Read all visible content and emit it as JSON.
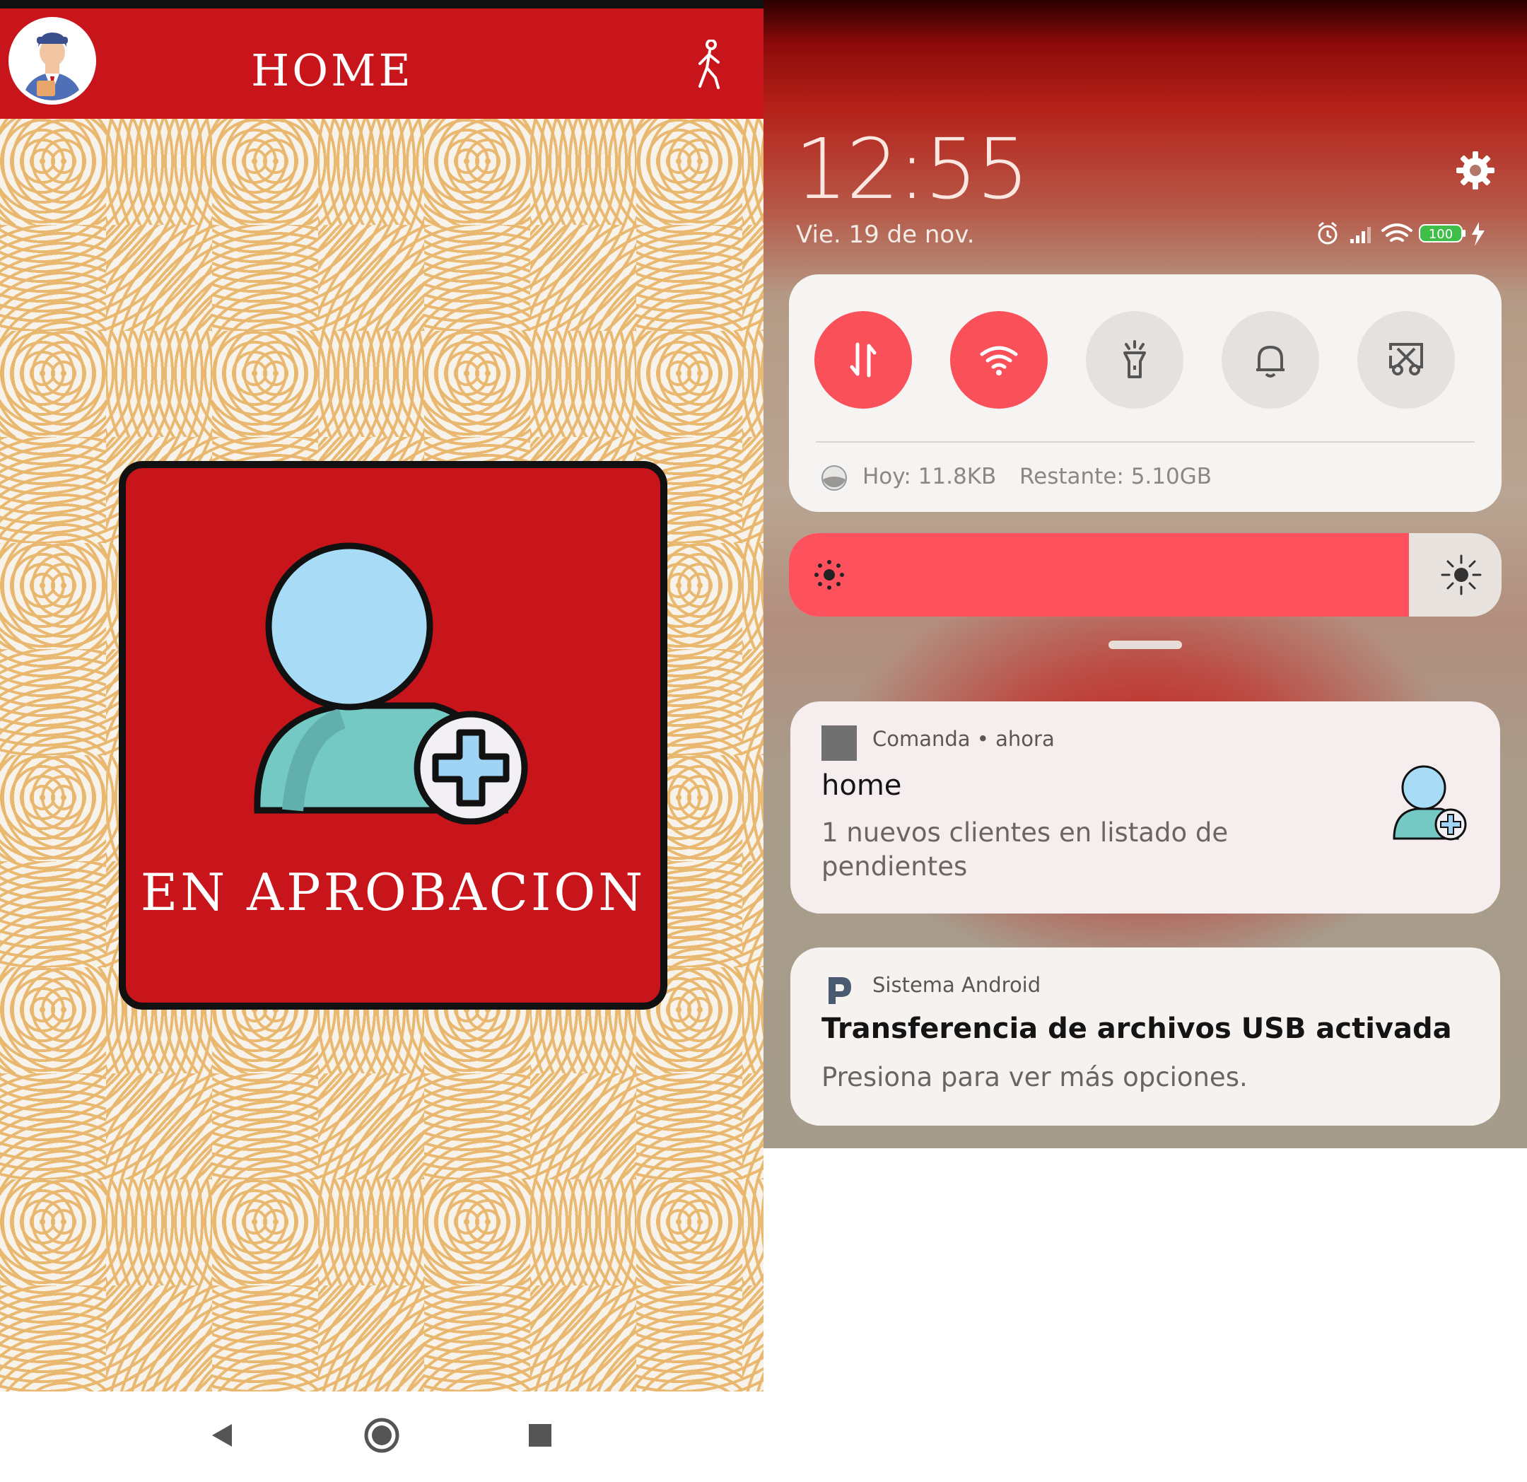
{
  "app": {
    "title": "HOME",
    "avatar_icon": "businessman-avatar-icon",
    "logout_icon": "walking-person-icon",
    "card_label": "EN APROBACION",
    "card_icon": "add-user-icon",
    "nav": [
      "back-icon",
      "home-icon",
      "recents-icon"
    ],
    "colors": {
      "primary": "#c8141b",
      "pattern": "#e8b66c"
    }
  },
  "shade": {
    "time": "12:55",
    "date": "Vie. 19 de nov.",
    "battery": "100",
    "status_icons": [
      "alarm-icon",
      "signal-icon",
      "wifi-icon",
      "battery-icon",
      "charging-icon"
    ],
    "quick_settings": [
      {
        "name": "mobile-data-icon",
        "active": true
      },
      {
        "name": "wifi-icon",
        "active": true
      },
      {
        "name": "flashlight-icon",
        "active": false
      },
      {
        "name": "bell-icon",
        "active": false
      },
      {
        "name": "screenshot-icon",
        "active": false
      }
    ],
    "data_today": "Hoy: 11.8KB",
    "data_remaining": "Restante: 5.10GB",
    "brightness_level": 0.87,
    "colors": {
      "accent": "#fd525d"
    }
  },
  "notifications": [
    {
      "app": "Comanda",
      "time": "ahora",
      "title": "home",
      "body_line1": "1 nuevos clientes  en listado de",
      "body_line2": "pendientes"
    },
    {
      "app": "Sistema Android",
      "title": "Transferencia de archivos USB activada",
      "body": "Presiona para ver más opciones."
    }
  ]
}
